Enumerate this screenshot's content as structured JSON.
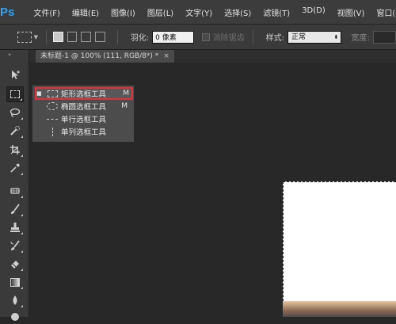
{
  "app": {
    "logo": "Ps"
  },
  "menu": [
    "文件(F)",
    "编辑(E)",
    "图像(I)",
    "图层(L)",
    "文字(Y)",
    "选择(S)",
    "滤镜(T)",
    "3D(D)",
    "视图(V)",
    "窗口(W)"
  ],
  "options_bar": {
    "feather_label": "羽化:",
    "feather_value": "0 像素",
    "antialias_label": "消除锯齿",
    "style_label": "样式:",
    "style_value": "正常",
    "width_label": "宽度:"
  },
  "document": {
    "tab_title": "未标题-1 @ 100% (111, RGB/8*) *",
    "close": "×"
  },
  "toolbar": {
    "handle": "»",
    "tools": [
      "move-tool",
      "rectangular-marquee-tool",
      "lasso-tool",
      "quick-selection-tool",
      "crop-tool",
      "eyedropper-tool",
      "spot-healing-tool",
      "brush-tool",
      "clone-stamp-tool",
      "history-brush-tool",
      "eraser-tool",
      "gradient-tool",
      "blur-tool",
      "dodge-tool"
    ]
  },
  "flyout": {
    "items": [
      {
        "label": "矩形选框工具",
        "shortcut": "M",
        "icon": "rectangular-marquee-icon",
        "selected": true
      },
      {
        "label": "椭圆选框工具",
        "shortcut": "M",
        "icon": "elliptical-marquee-icon",
        "selected": false
      },
      {
        "label": "单行选框工具",
        "shortcut": "",
        "icon": "single-row-marquee-icon",
        "selected": false
      },
      {
        "label": "单列选框工具",
        "shortcut": "",
        "icon": "single-column-marquee-icon",
        "selected": false
      }
    ]
  },
  "colors": {
    "accent_ps": "#2fa3f5",
    "highlight": "#e0303a",
    "workspace": "#282828"
  }
}
